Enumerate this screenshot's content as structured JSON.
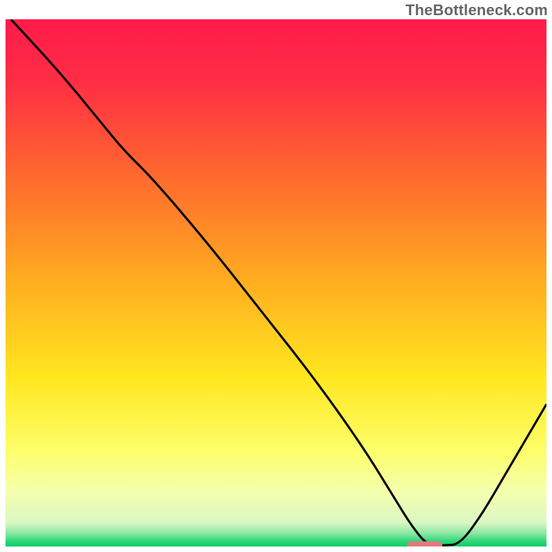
{
  "watermark": "TheBottleneck.com",
  "chart_data": {
    "type": "line",
    "title": "",
    "xlabel": "",
    "ylabel": "",
    "xlim": [
      0,
      100
    ],
    "ylim": [
      0,
      100
    ],
    "gradient_stops": [
      {
        "offset": 0.0,
        "color": "#ff1b4b"
      },
      {
        "offset": 0.12,
        "color": "#ff2e44"
      },
      {
        "offset": 0.3,
        "color": "#ff6a2e"
      },
      {
        "offset": 0.5,
        "color": "#ffae20"
      },
      {
        "offset": 0.68,
        "color": "#ffe71f"
      },
      {
        "offset": 0.82,
        "color": "#fdff6b"
      },
      {
        "offset": 0.9,
        "color": "#f4ffb0"
      },
      {
        "offset": 0.955,
        "color": "#d9f7c2"
      },
      {
        "offset": 0.975,
        "color": "#8be7a4"
      },
      {
        "offset": 0.99,
        "color": "#2fd878"
      },
      {
        "offset": 1.0,
        "color": "#0acc61"
      }
    ],
    "series": [
      {
        "name": "bottleneck-curve",
        "x": [
          1,
          10,
          18,
          22,
          27,
          37,
          47,
          57,
          66,
          72,
          75,
          78,
          81,
          84,
          88,
          92,
          96,
          100
        ],
        "y": [
          100,
          90,
          80,
          75,
          70,
          58,
          45,
          32,
          19,
          9,
          4,
          0.2,
          0.2,
          0.4,
          6,
          13,
          20,
          27
        ]
      }
    ],
    "marker": {
      "name": "optimal-segment",
      "x": 77.5,
      "y": 0.2,
      "width_x": 6.5,
      "color": "#e07a7f"
    }
  }
}
